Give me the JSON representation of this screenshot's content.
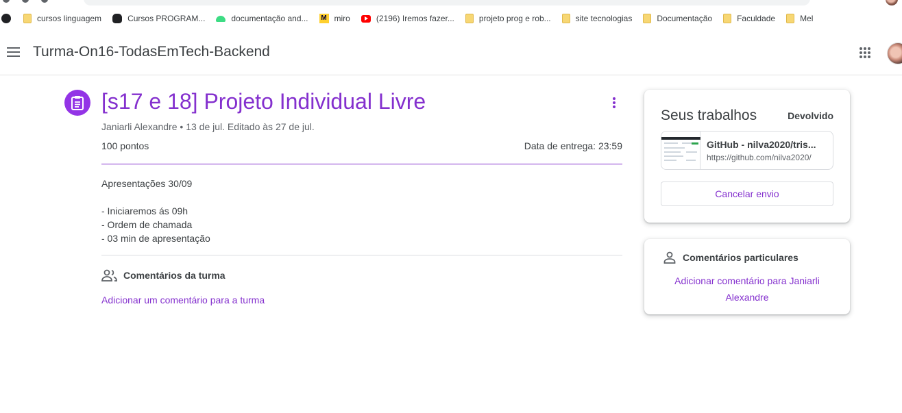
{
  "bookmarks": [
    {
      "label": "cursos linguagem",
      "icon": "folder-icon"
    },
    {
      "label": "Cursos  PROGRAM...",
      "icon": "cat-icon"
    },
    {
      "label": "documentação and...",
      "icon": "android-icon"
    },
    {
      "label": "miro",
      "icon": "miro-icon"
    },
    {
      "label": "(2196) Iremos fazer...",
      "icon": "youtube-icon"
    },
    {
      "label": "projeto prog e rob...",
      "icon": "folder-icon"
    },
    {
      "label": "site tecnologias",
      "icon": "folder-icon"
    },
    {
      "label": "Documentação",
      "icon": "folder-icon"
    },
    {
      "label": "Faculdade",
      "icon": "folder-icon"
    },
    {
      "label": "Mel",
      "icon": "folder-icon"
    }
  ],
  "header": {
    "class_name": "Turma-On16-TodasEmTech-Backend"
  },
  "assignment": {
    "title": "[s17 e 18] Projeto Individual Livre",
    "meta": "Janiarli Alexandre • 13 de jul. Editado às 27 de jul.",
    "points": "100 pontos",
    "due": "Data de entrega: 23:59",
    "description": [
      "Apresentações 30/09",
      "",
      "- Iniciaremos ás 09h",
      "- Ordem de chamada",
      "- 03 min de apresentação"
    ],
    "class_comments_label": "Comentários da turma",
    "add_class_comment": "Adicionar um comentário para a turma"
  },
  "your_work": {
    "title": "Seus trabalhos",
    "status": "Devolvido",
    "attachment_title": "GitHub - nilva2020/tris...",
    "attachment_url": "https://github.com/nilva2020/",
    "cancel_label": "Cancelar envio"
  },
  "private_comments": {
    "label": "Comentários particulares",
    "add_link": "Adicionar comentário para Janiarli Alexandre"
  },
  "colors": {
    "accent": "#8430ce",
    "icon_bg": "#9334e6"
  }
}
